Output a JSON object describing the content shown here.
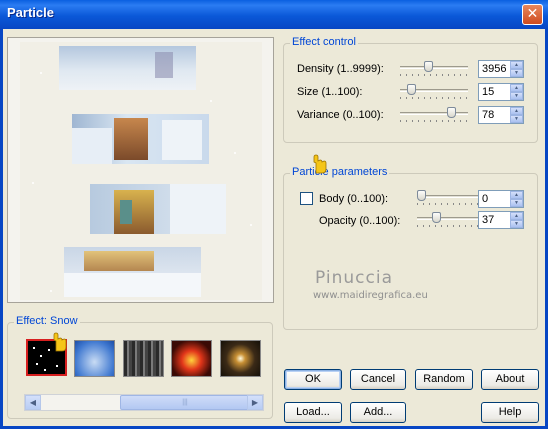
{
  "window": {
    "title": "Particle",
    "close_icon": "close-icon"
  },
  "effect_control": {
    "group_label": "Effect control",
    "density": {
      "label": "Density (1..9999):",
      "value": "3956"
    },
    "size": {
      "label": "Size (1..100):",
      "value": "15"
    },
    "variance": {
      "label": "Variance (0..100):",
      "value": "78"
    }
  },
  "particle_parameters": {
    "group_label": "Particle parameters",
    "body": {
      "label": "Body (0..100):",
      "value": "0"
    },
    "opacity": {
      "label": "Opacity (0..100):",
      "value": "37"
    }
  },
  "effect_gallery": {
    "group_label": "Effect: Snow",
    "thumbnails": [
      "snow",
      "sky",
      "smoke",
      "fire",
      "star"
    ]
  },
  "buttons": {
    "ok": "OK",
    "cancel": "Cancel",
    "random": "Random",
    "about": "About",
    "load": "Load...",
    "add": "Add...",
    "help": "Help"
  },
  "watermark": {
    "name": "Pinuccia",
    "url": "www.maidiregrafica.eu"
  },
  "colors": {
    "title_bar": "#0a5fe0",
    "group_label": "#0046d5",
    "selected_thumb": "#d71f1f"
  }
}
